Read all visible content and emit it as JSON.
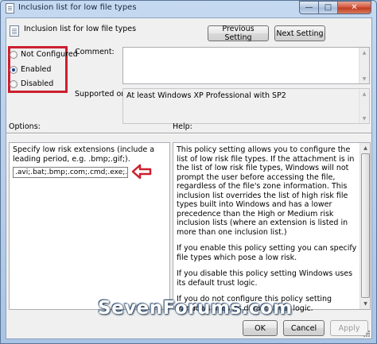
{
  "window": {
    "title": "Inclusion list for low file types",
    "minimize_glyph": "—",
    "maximize_glyph": "□",
    "close_glyph": "✕"
  },
  "header": {
    "policy_title": "Inclusion list for low file types",
    "previous_label": "Previous Setting",
    "next_label": "Next Setting"
  },
  "state": {
    "options": [
      {
        "label": "Not Configured",
        "checked": false
      },
      {
        "label": "Enabled",
        "checked": true
      },
      {
        "label": "Disabled",
        "checked": false
      }
    ],
    "highlight_color": "#cc1f2f"
  },
  "comment": {
    "label": "Comment:",
    "value": ""
  },
  "supported": {
    "label": "Supported on:",
    "value": "At least Windows XP Professional with SP2"
  },
  "options_section": {
    "label": "Options:",
    "description": "Specify low risk extensions (include a leading period, e.g. .bmp;.gif;).",
    "extensions_value": ".avi;.bat;.bmp;.com;.cmd;.exe;.gif;.htm;.h"
  },
  "help_section": {
    "label": "Help:",
    "paragraphs": [
      "This policy setting allows you to configure the list of low risk file types. If the attachment is in the list of low risk file types, Windows will not prompt the user before accessing the file, regardless of the file's zone information. This inclusion list overrides the list of high risk file types built into Windows and has a lower precedence than the High or Medium risk inclusion lists (where an extension is listed in more than one inclusion list.)",
      "If you enable this policy setting you can specify file types which pose a low risk.",
      "If you disable this policy setting Windows uses its default trust logic.",
      "If you do not configure this policy setting Windows uses its default trust logic."
    ]
  },
  "watermark": "SevenForums.com",
  "footer": {
    "ok_label": "OK",
    "cancel_label": "Cancel",
    "apply_label": "Apply"
  },
  "icons": {
    "app": "policy-document-icon",
    "arrow": "red-arrow-left-icon"
  }
}
